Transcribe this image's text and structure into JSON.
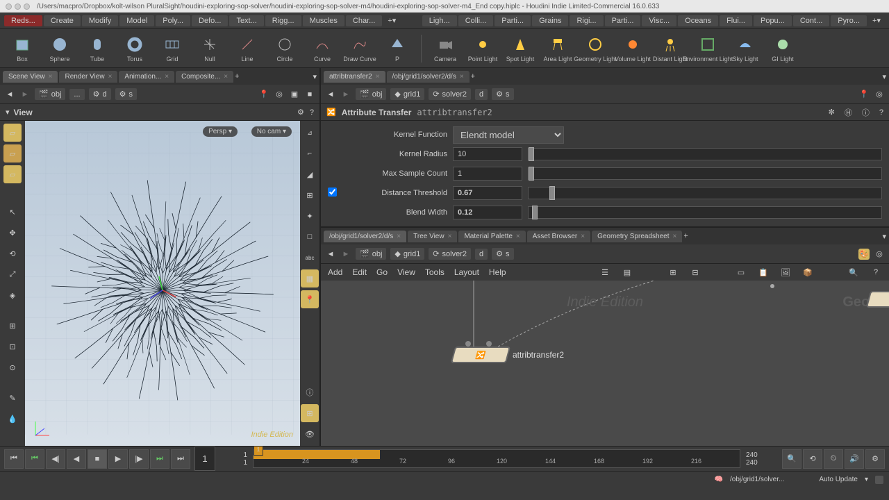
{
  "titlebar": {
    "path": "/Users/macpro/Dropbox/kolt-wilson PluralSight/houdini-exploring-sop-solver/houdini-exploring-sop-solver-m4/houdini-exploring-sop-solver-m4_End copy.hiplc - Houdini Indie Limited-Commercial 16.0.633"
  },
  "menubar": {
    "items": [
      "Reds...",
      "Create",
      "Modify",
      "Model",
      "Poly...",
      "Defo...",
      "Text...",
      "Rigg...",
      "Muscles",
      "Char..."
    ],
    "items2": [
      "Ligh...",
      "Colli...",
      "Parti...",
      "Grains",
      "Rigi...",
      "Parti...",
      "Visc...",
      "Oceans",
      "Flui...",
      "Popu...",
      "Cont...",
      "Pyro..."
    ]
  },
  "shelf": {
    "items": [
      "Box",
      "Sphere",
      "Tube",
      "Torus",
      "Grid",
      "Null",
      "Line",
      "Circle",
      "Curve",
      "Draw Curve",
      "P"
    ],
    "items2": [
      "Camera",
      "Point Light",
      "Spot Light",
      "Area Light",
      "Geometry Light",
      "Volume Light",
      "Distant Light",
      "Environment Light",
      "Sky Light",
      "GI Light"
    ]
  },
  "left": {
    "tabs": [
      "Scene View",
      "Render View",
      "Animation...",
      "Composite..."
    ],
    "breadcrumb": {
      "obj": "obj",
      "dots": "...",
      "d": "d",
      "s": "s"
    },
    "view_label": "View",
    "persp": "Persp",
    "nocam": "No cam",
    "watermark": "Indie Edition"
  },
  "params": {
    "tabs": [
      "attribtransfer2",
      "/obj/grid1/solver2/d/s"
    ],
    "breadcrumb": {
      "obj": "obj",
      "grid1": "grid1",
      "solver2": "solver2",
      "d": "d",
      "s": "s"
    },
    "title": "Attribute Transfer",
    "name": "attribtransfer2",
    "rows": {
      "kernel_function": {
        "label": "Kernel Function",
        "value": "Elendt model"
      },
      "kernel_radius": {
        "label": "Kernel Radius",
        "value": "10"
      },
      "max_sample_count": {
        "label": "Max Sample Count",
        "value": "1"
      },
      "distance_threshold": {
        "label": "Distance Threshold",
        "value": "0.67"
      },
      "blend_width": {
        "label": "Blend Width",
        "value": "0.12"
      }
    }
  },
  "network": {
    "tabs": [
      "/obj/grid1/solver2/d/s",
      "Tree View",
      "Material Palette",
      "Asset Browser",
      "Geometry Spreadsheet"
    ],
    "breadcrumb": {
      "obj": "obj",
      "grid1": "grid1",
      "solver2": "solver2",
      "d": "d",
      "s": "s"
    },
    "menu": [
      "Add",
      "Edit",
      "Go",
      "View",
      "Tools",
      "Layout",
      "Help"
    ],
    "node_label": "attribtransfer2",
    "watermark": "Indie Edition",
    "watermark2": "Geom"
  },
  "timeline": {
    "current": "1",
    "start": "1",
    "end": "240",
    "total": "240",
    "ticks": [
      "1",
      "24",
      "48",
      "72",
      "96",
      "120",
      "144",
      "168",
      "192",
      "216",
      "240"
    ]
  },
  "statusbar": {
    "path": "/obj/grid1/solver...",
    "mode": "Auto Update"
  }
}
